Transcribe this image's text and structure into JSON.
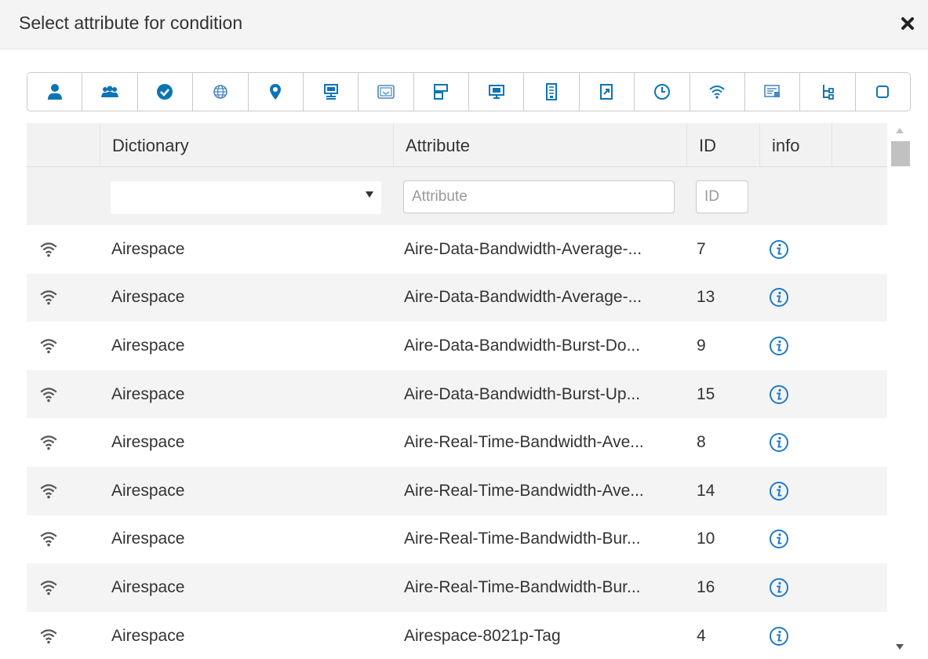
{
  "dialog": {
    "title": "Select attribute for condition",
    "close_icon": "close-icon"
  },
  "toolbar": {
    "icons": [
      "user-icon",
      "user-group-icon",
      "check-circle-icon",
      "globe-icon",
      "location-pin-icon",
      "network-device-icon",
      "certificate-icon",
      "endpoint-policy-icon",
      "monitor-icon",
      "server-icon",
      "file-icon",
      "clock-icon",
      "wifi-icon",
      "card-icon",
      "tree-icon",
      "square-icon"
    ],
    "accent_color": "#0d74b4"
  },
  "table": {
    "columns": {
      "dictionary": "Dictionary",
      "attribute": "Attribute",
      "id": "ID",
      "info": "info"
    },
    "filters": {
      "dictionary_value": "",
      "attribute_placeholder": "Attribute",
      "id_placeholder": "ID"
    },
    "rows": [
      {
        "dictionary": "Airespace",
        "attribute": "Aire-Data-Bandwidth-Average-...",
        "id": "7"
      },
      {
        "dictionary": "Airespace",
        "attribute": "Aire-Data-Bandwidth-Average-...",
        "id": "13"
      },
      {
        "dictionary": "Airespace",
        "attribute": "Aire-Data-Bandwidth-Burst-Do...",
        "id": "9"
      },
      {
        "dictionary": "Airespace",
        "attribute": "Aire-Data-Bandwidth-Burst-Up...",
        "id": "15"
      },
      {
        "dictionary": "Airespace",
        "attribute": "Aire-Real-Time-Bandwidth-Ave...",
        "id": "8"
      },
      {
        "dictionary": "Airespace",
        "attribute": "Aire-Real-Time-Bandwidth-Ave...",
        "id": "14"
      },
      {
        "dictionary": "Airespace",
        "attribute": "Aire-Real-Time-Bandwidth-Bur...",
        "id": "10"
      },
      {
        "dictionary": "Airespace",
        "attribute": "Aire-Real-Time-Bandwidth-Bur...",
        "id": "16"
      },
      {
        "dictionary": "Airespace",
        "attribute": "Airespace-8021p-Tag",
        "id": "4"
      }
    ],
    "row_icon": "wifi-icon",
    "info_icon": "info-icon",
    "info_color": "#1f7ac4"
  }
}
